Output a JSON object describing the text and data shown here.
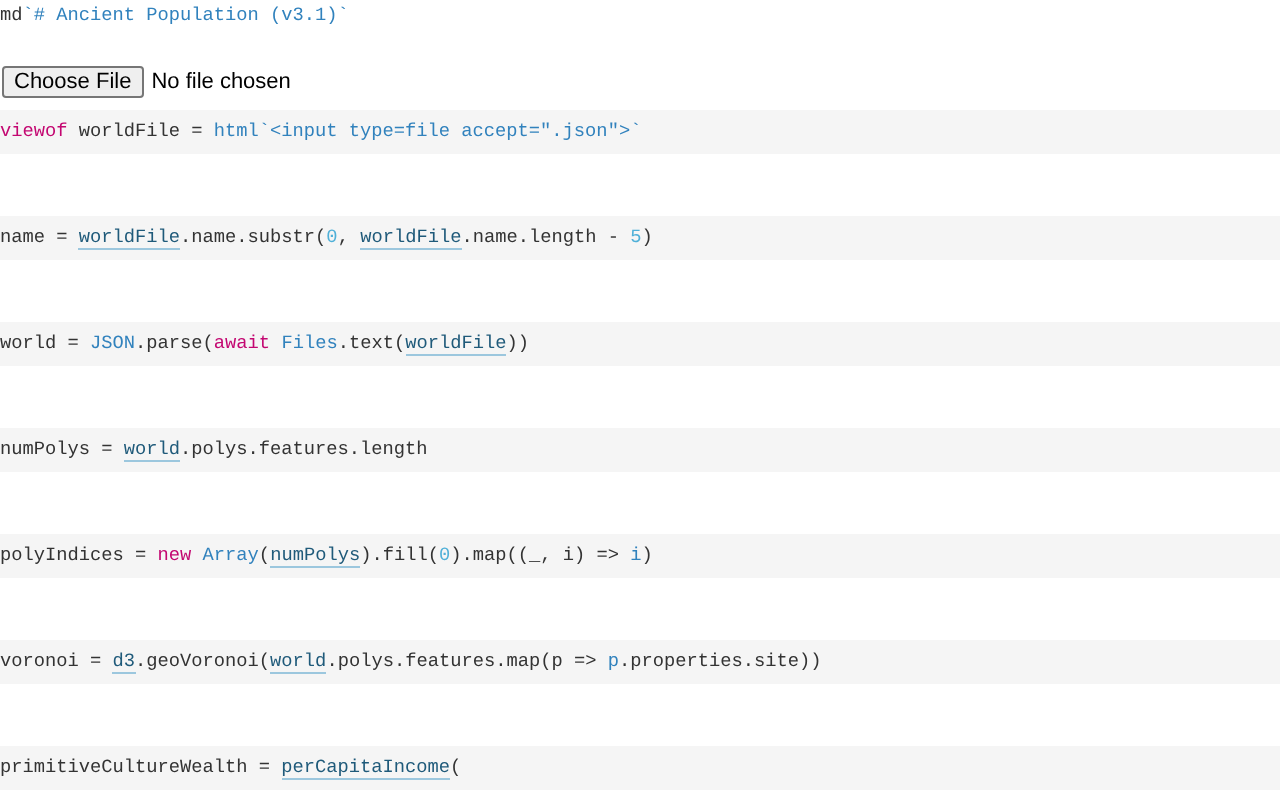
{
  "header_cell": {
    "tokens": [
      {
        "text": "md",
        "kind": "plain"
      },
      {
        "text": "`# Ancient Population (v3.1)`",
        "kind": "string"
      }
    ]
  },
  "file_input": {
    "button": "Choose File",
    "status": "No file chosen"
  },
  "cells": [
    {
      "tokens": [
        {
          "text": "viewof",
          "kind": "keyword"
        },
        {
          "text": " worldFile = ",
          "kind": "plain"
        },
        {
          "text": "html`<input type=file accept=\".json\">`",
          "kind": "string"
        }
      ]
    },
    {
      "tokens": [
        {
          "text": "name = ",
          "kind": "plain"
        },
        {
          "text": "worldFile",
          "kind": "ref"
        },
        {
          "text": ".name.substr(",
          "kind": "plain"
        },
        {
          "text": "0",
          "kind": "number"
        },
        {
          "text": ", ",
          "kind": "plain"
        },
        {
          "text": "worldFile",
          "kind": "ref"
        },
        {
          "text": ".name.length - ",
          "kind": "plain"
        },
        {
          "text": "5",
          "kind": "number"
        },
        {
          "text": ")",
          "kind": "plain"
        }
      ]
    },
    {
      "tokens": [
        {
          "text": "world = ",
          "kind": "plain"
        },
        {
          "text": "JSON",
          "kind": "global"
        },
        {
          "text": ".parse(",
          "kind": "plain"
        },
        {
          "text": "await ",
          "kind": "keyword"
        },
        {
          "text": "Files",
          "kind": "global"
        },
        {
          "text": ".text(",
          "kind": "plain"
        },
        {
          "text": "worldFile",
          "kind": "ref"
        },
        {
          "text": "))",
          "kind": "plain"
        }
      ]
    },
    {
      "tokens": [
        {
          "text": "numPolys = ",
          "kind": "plain"
        },
        {
          "text": "world",
          "kind": "ref"
        },
        {
          "text": ".polys.features.length",
          "kind": "plain"
        }
      ]
    },
    {
      "tokens": [
        {
          "text": "polyIndices = ",
          "kind": "plain"
        },
        {
          "text": "new ",
          "kind": "keyword"
        },
        {
          "text": "Array",
          "kind": "global"
        },
        {
          "text": "(",
          "kind": "plain"
        },
        {
          "text": "numPolys",
          "kind": "ref"
        },
        {
          "text": ").fill(",
          "kind": "plain"
        },
        {
          "text": "0",
          "kind": "number"
        },
        {
          "text": ").map((_, i) => ",
          "kind": "plain"
        },
        {
          "text": "i",
          "kind": "param"
        },
        {
          "text": ")",
          "kind": "plain"
        }
      ]
    },
    {
      "tokens": [
        {
          "text": "voronoi = ",
          "kind": "plain"
        },
        {
          "text": "d3",
          "kind": "ref"
        },
        {
          "text": ".geoVoronoi(",
          "kind": "plain"
        },
        {
          "text": "world",
          "kind": "ref"
        },
        {
          "text": ".polys.features.map(p => ",
          "kind": "plain"
        },
        {
          "text": "p",
          "kind": "param"
        },
        {
          "text": ".properties.site))",
          "kind": "plain"
        }
      ]
    },
    {
      "tokens": [
        {
          "text": "primitiveCultureWealth = ",
          "kind": "plain"
        },
        {
          "text": "perCapitaIncome",
          "kind": "ref"
        },
        {
          "text": "(",
          "kind": "plain"
        }
      ]
    }
  ]
}
